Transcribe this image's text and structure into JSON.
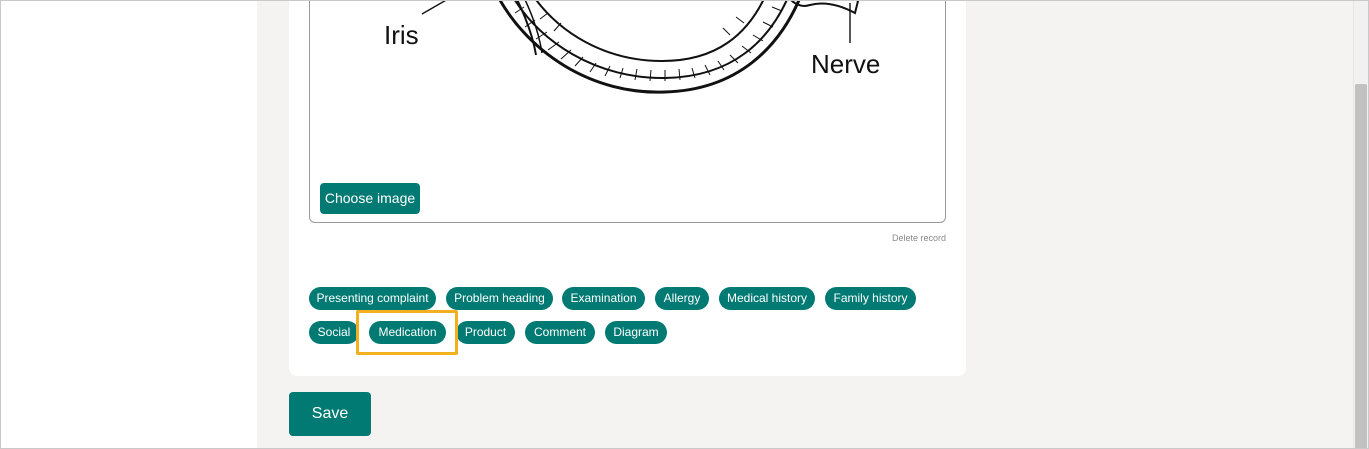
{
  "diagram": {
    "label_iris": "Iris",
    "label_nerve": "Nerve",
    "choose_image_label": "Choose image"
  },
  "record": {
    "delete_label": "Delete record"
  },
  "tags": [
    {
      "label": "Presenting complaint"
    },
    {
      "label": "Problem heading"
    },
    {
      "label": "Examination"
    },
    {
      "label": "Allergy"
    },
    {
      "label": "Medical history"
    },
    {
      "label": "Family history"
    },
    {
      "label": "Social"
    },
    {
      "label": "Medication",
      "highlighted": true
    },
    {
      "label": "Product"
    },
    {
      "label": "Comment"
    },
    {
      "label": "Diagram"
    }
  ],
  "actions": {
    "save_label": "Save"
  },
  "colors": {
    "primary": "#007a73",
    "highlight": "#f2b01e",
    "background": "#f4f3f1"
  }
}
